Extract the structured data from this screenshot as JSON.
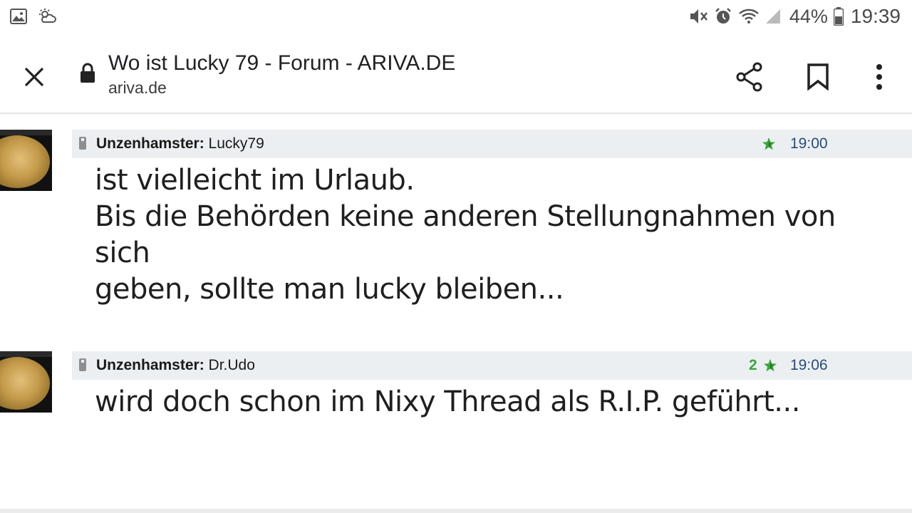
{
  "status_bar": {
    "battery_percent": "44%",
    "time": "19:39",
    "left_icons": [
      "gallery-icon",
      "weather-icon"
    ],
    "right_icons": [
      "mute-icon",
      "alarm-icon",
      "wifi-icon",
      "signal-icon",
      "battery-icon"
    ]
  },
  "toolbar": {
    "title": "Wo ist Lucky 79 - Forum - ARIVA.DE",
    "url": "ariva.de",
    "icons": [
      "close-icon",
      "lock-icon",
      "share-icon",
      "bookmark-icon",
      "more-vert-icon"
    ]
  },
  "posts": [
    {
      "group": "Unzenhamster:",
      "user": "Lucky79",
      "stars": "",
      "time": "19:00",
      "lines": [
        "ist vielleicht im Urlaub.",
        "Bis die Behörden keine anderen Stellungnahmen von sich",
        "geben, sollte man lucky bleiben..."
      ]
    },
    {
      "group": "Unzenhamster:",
      "user": "Dr.Udo",
      "stars": "2",
      "time": "19:06",
      "lines": [
        "wird doch schon im Nixy Thread als R.I.P. geführt..."
      ]
    }
  ],
  "colors": {
    "header_bg": "#eceff2",
    "star_green": "#3aa53a",
    "time_blue": "#264d7a"
  }
}
